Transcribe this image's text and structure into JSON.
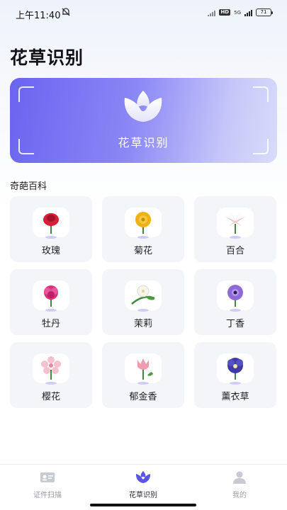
{
  "status_bar": {
    "time": "上午11:40",
    "network": "5G",
    "hd": "HD",
    "battery": "71"
  },
  "page_title": "花草识别",
  "hero": {
    "label": "花草识别",
    "icon": "flower-scan-icon"
  },
  "section_title": "奇葩百科",
  "flowers": [
    {
      "name": "玫瑰",
      "color": "#d4213a"
    },
    {
      "name": "菊花",
      "color": "#f0b114"
    },
    {
      "name": "百合",
      "color": "#f2c9d6"
    },
    {
      "name": "牡丹",
      "color": "#d8327a"
    },
    {
      "name": "茉莉",
      "color": "#f7f4ee"
    },
    {
      "name": "丁香",
      "color": "#8f6ad6"
    },
    {
      "name": "樱花",
      "color": "#f6c1cc"
    },
    {
      "name": "郁金香",
      "color": "#f19bb0"
    },
    {
      "name": "薰衣草",
      "color": "#3f3aa6"
    }
  ],
  "tabbar": {
    "items": [
      {
        "label": "证件扫描",
        "icon": "id-card-icon"
      },
      {
        "label": "花草识别",
        "icon": "flower-icon"
      },
      {
        "label": "我的",
        "icon": "user-icon"
      }
    ],
    "active_color": "#5b55e6",
    "inactive_color": "#c7c9d3"
  }
}
